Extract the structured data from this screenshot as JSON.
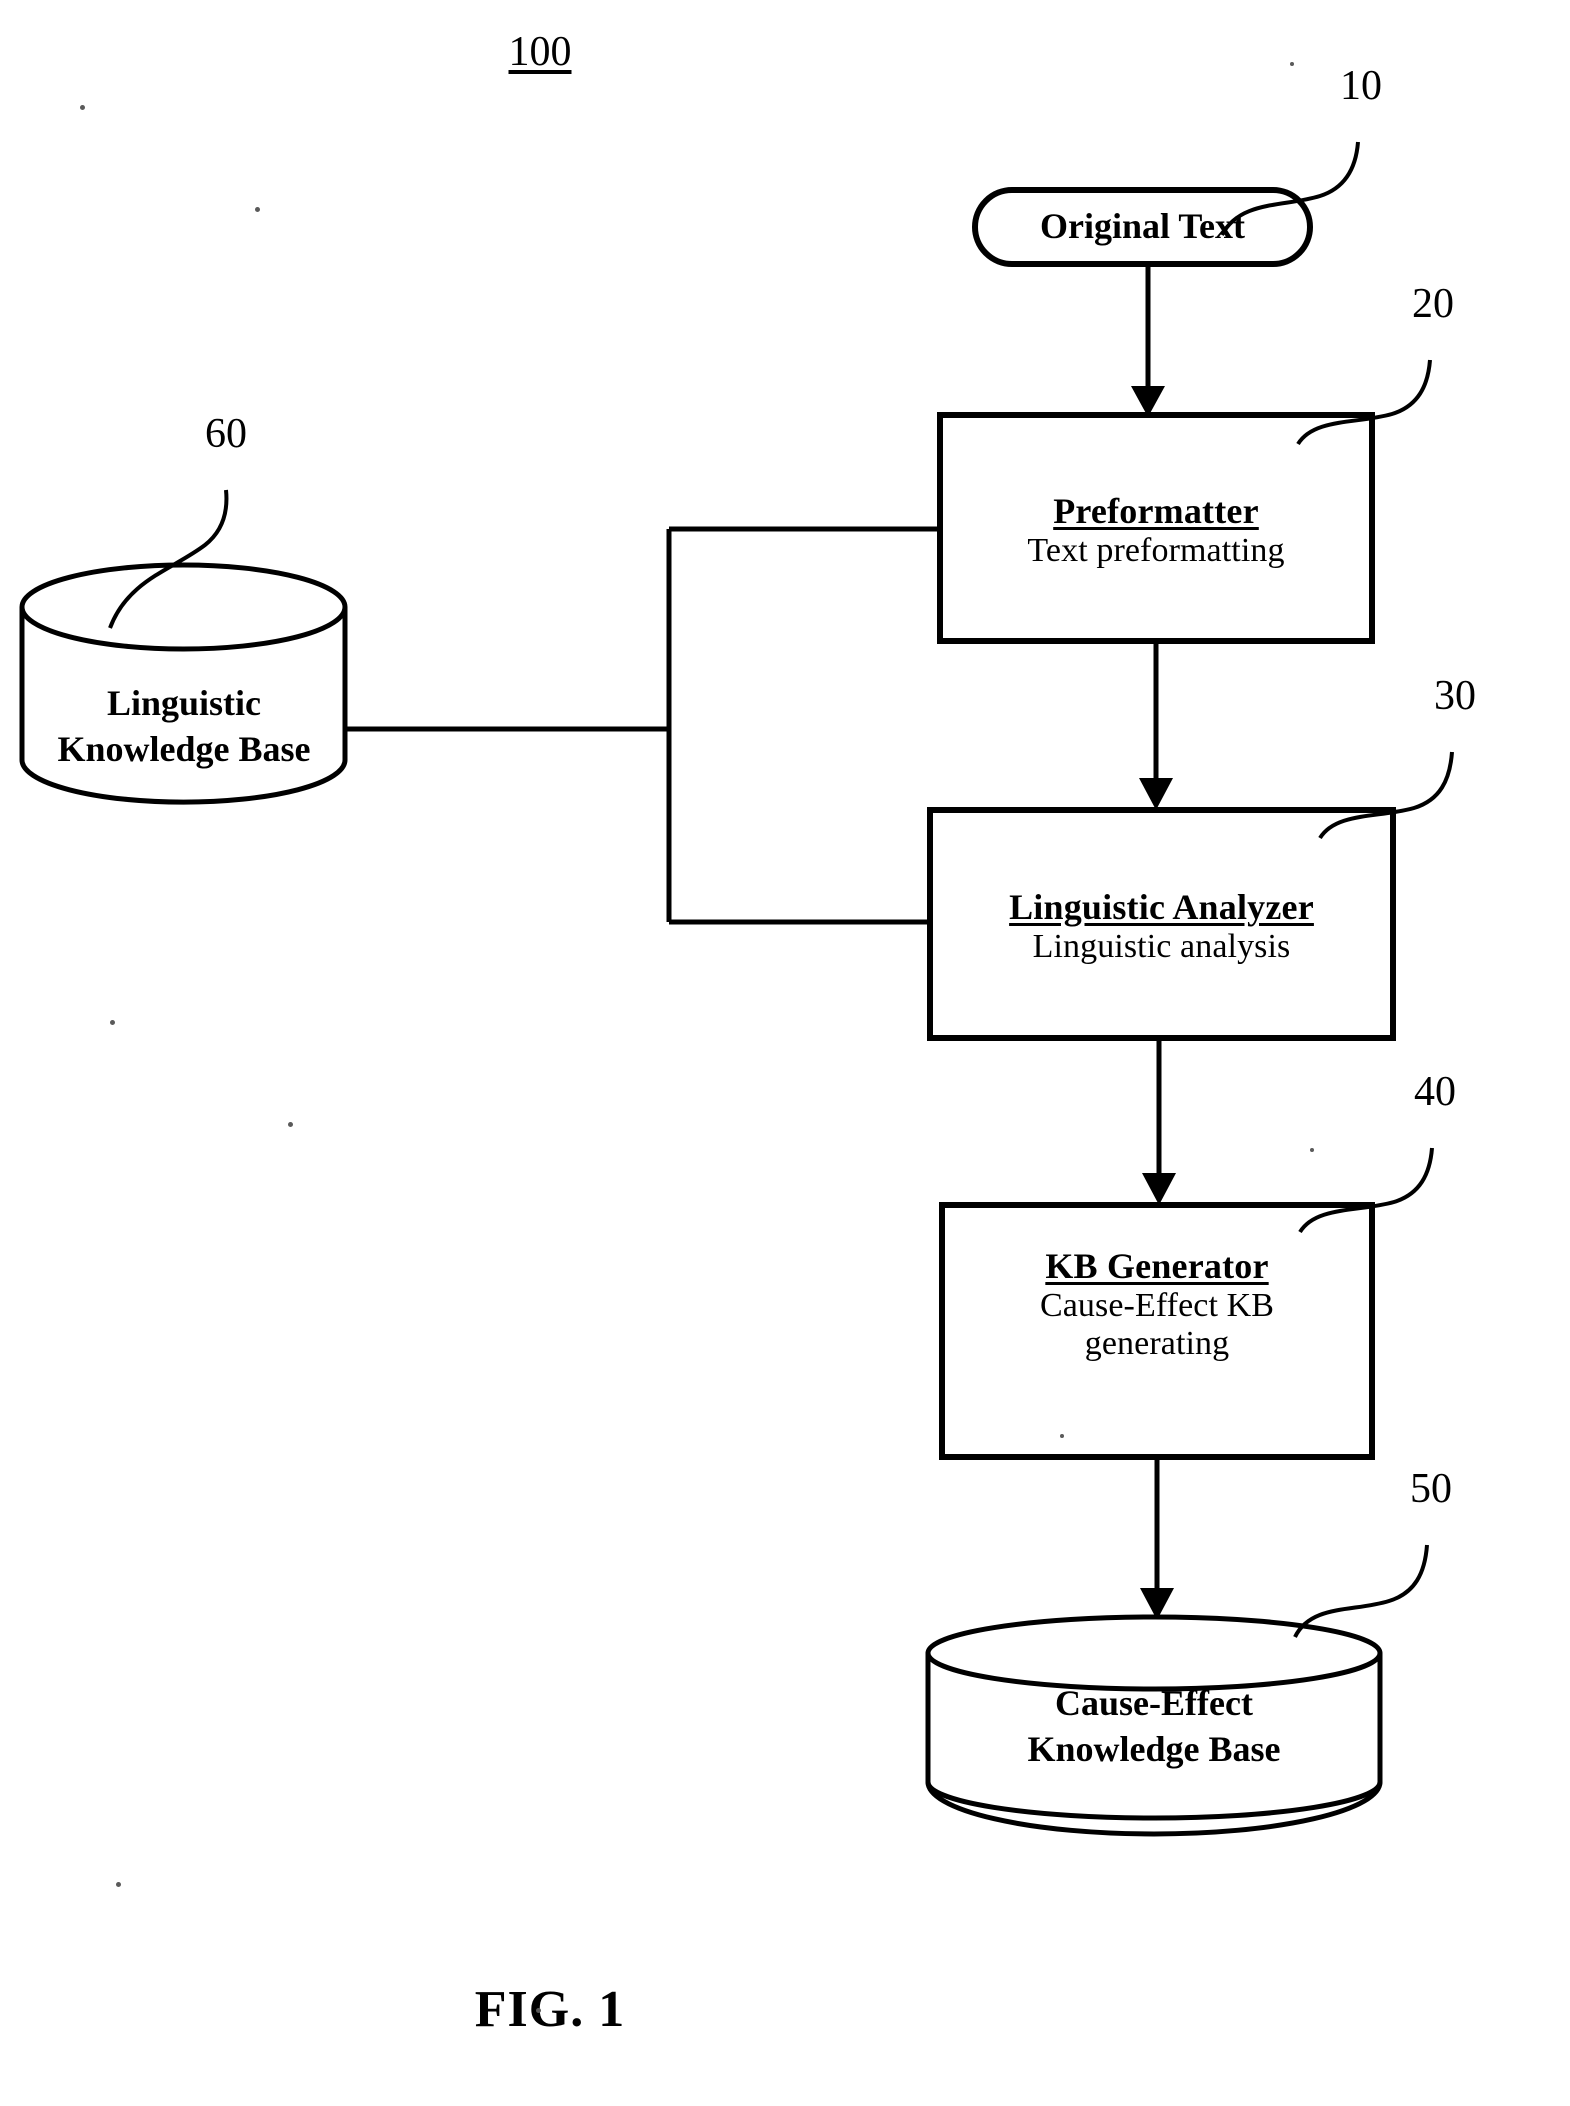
{
  "figure": {
    "system_number": "100",
    "caption": "FIG. 1"
  },
  "nodes": {
    "original_text": {
      "ref": "10",
      "label": "Original Text",
      "shape": "stadium"
    },
    "preformatter": {
      "ref": "20",
      "title": "Preformatter",
      "subtitle": "Text preformatting",
      "shape": "rectangle"
    },
    "linguistic_analyzer": {
      "ref": "30",
      "title": "Linguistic Analyzer",
      "subtitle": "Linguistic analysis",
      "shape": "rectangle"
    },
    "kb_generator": {
      "ref": "40",
      "title": "KB Generator",
      "subtitle": "Cause-Effect KB\ngenerating",
      "shape": "rectangle"
    },
    "cause_effect_kb": {
      "ref": "50",
      "label": "Cause-Effect\nKnowledge Base",
      "shape": "cylinder"
    },
    "linguistic_kb": {
      "ref": "60",
      "label": "Linguistic\nKnowledge Base",
      "shape": "cylinder"
    }
  },
  "colors": {
    "ink": "#000000",
    "paper": "#ffffff"
  }
}
